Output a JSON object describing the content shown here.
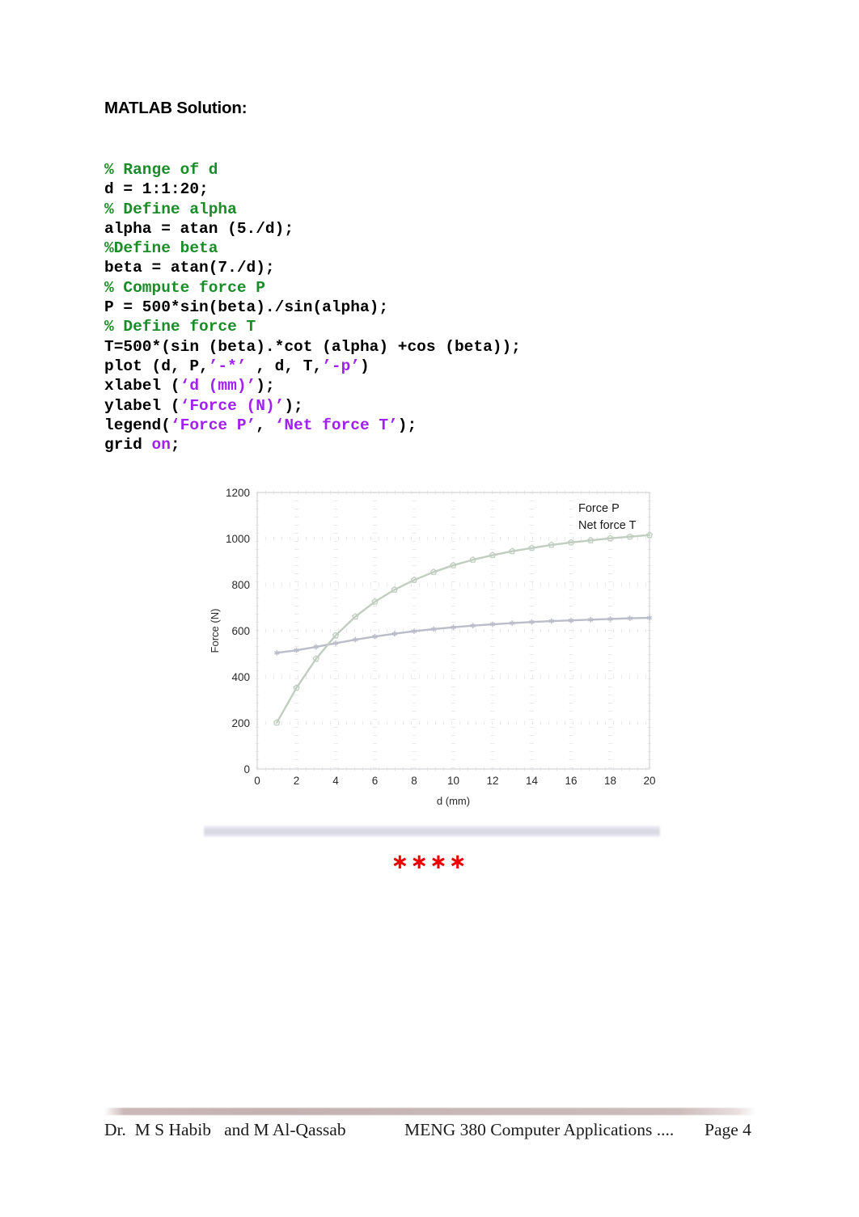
{
  "document": {
    "heading": "MATLAB Solution:",
    "separator": "∗∗∗∗",
    "separator_color": "#ee0000"
  },
  "code": {
    "language": "matlab",
    "comment_color": "#1a8c28",
    "string_color": "#a020f0",
    "text_color": "#000000",
    "lines": [
      {
        "type": "comment",
        "text": "% Range of d"
      },
      {
        "type": "code",
        "text": "d = 1:1:20;"
      },
      {
        "type": "comment",
        "text": "% Define alpha"
      },
      {
        "type": "code",
        "text": "alpha = atan (5./d);"
      },
      {
        "type": "comment",
        "text": "%Define beta"
      },
      {
        "type": "code",
        "text": "beta = atan(7./d);"
      },
      {
        "type": "comment",
        "text": "% Compute force P"
      },
      {
        "type": "code",
        "text": "P = 500*sin(beta)./sin(alpha);"
      },
      {
        "type": "comment",
        "text": "% Define force T"
      },
      {
        "type": "code",
        "text": "T=500*(sin (beta).*cot (alpha) +cos (beta));"
      },
      {
        "type": "mixed",
        "parts": [
          {
            "cls": "plain",
            "text": "plot (d, P,"
          },
          {
            "cls": "string",
            "text": "’-*’"
          },
          {
            "cls": "plain",
            "text": " , d, T,"
          },
          {
            "cls": "string",
            "text": "’-p’"
          },
          {
            "cls": "plain",
            "text": ")"
          }
        ]
      },
      {
        "type": "mixed",
        "parts": [
          {
            "cls": "plain",
            "text": "xlabel ("
          },
          {
            "cls": "string",
            "text": "‘d (mm)’"
          },
          {
            "cls": "plain",
            "text": ");"
          }
        ]
      },
      {
        "type": "mixed",
        "parts": [
          {
            "cls": "plain",
            "text": "ylabel ("
          },
          {
            "cls": "string",
            "text": "‘Force (N)’"
          },
          {
            "cls": "plain",
            "text": ");"
          }
        ]
      },
      {
        "type": "mixed",
        "parts": [
          {
            "cls": "plain",
            "text": "legend("
          },
          {
            "cls": "string",
            "text": "‘Force P’"
          },
          {
            "cls": "plain",
            "text": ", "
          },
          {
            "cls": "string",
            "text": "‘Net force T’"
          },
          {
            "cls": "plain",
            "text": ");"
          }
        ]
      },
      {
        "type": "mixed",
        "parts": [
          {
            "cls": "plain",
            "text": "grid "
          },
          {
            "cls": "kw",
            "text": "on"
          },
          {
            "cls": "plain",
            "text": ";"
          }
        ]
      }
    ]
  },
  "chart_data": {
    "type": "line",
    "title": "",
    "xlabel": "d (mm)",
    "ylabel": "Force (N)",
    "xlim": [
      0,
      20
    ],
    "ylim": [
      0,
      1200
    ],
    "xticks": [
      0,
      2,
      4,
      6,
      8,
      10,
      12,
      14,
      16,
      18,
      20
    ],
    "yticks": [
      0,
      200,
      400,
      600,
      800,
      1000,
      1200
    ],
    "grid": true,
    "legend_position": "upper-right",
    "x": [
      1,
      2,
      3,
      4,
      5,
      6,
      7,
      8,
      9,
      10,
      11,
      12,
      13,
      14,
      15,
      16,
      17,
      18,
      19,
      20
    ],
    "series": [
      {
        "name": "Force P",
        "color": "#b9bad4",
        "marker": "*",
        "linestyle": "-",
        "values": [
          504,
          515,
          530,
          546,
          561,
          575,
          587,
          598,
          607,
          615,
          622,
          628,
          633,
          638,
          642,
          645,
          648,
          651,
          654,
          656
        ]
      },
      {
        "name": "Net force T",
        "color": "#b6cfb6",
        "marker": "p",
        "linestyle": "-",
        "values": [
          201,
          352,
          478,
          580,
          661,
          726,
          778,
          820,
          855,
          884,
          908,
          928,
          945,
          959,
          972,
          983,
          992,
          1001,
          1008,
          1015
        ]
      }
    ],
    "legend_entries": [
      "Force P",
      "Net force T"
    ]
  },
  "footer": {
    "left": "Dr.  M S Habib   and M Al-Qassab",
    "center": "MENG 380 Computer Applications ....",
    "right": "Page 4",
    "rule_color": "#c4b2b2"
  }
}
